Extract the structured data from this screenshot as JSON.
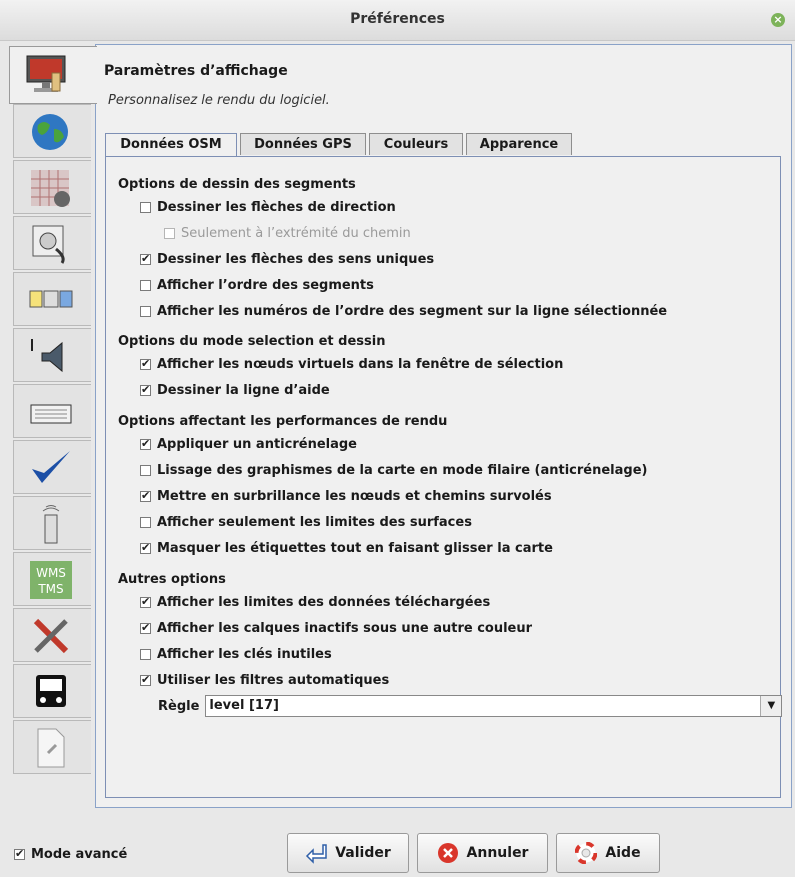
{
  "window": {
    "title": "Préférences"
  },
  "panel": {
    "title": "Paramètres d’affichage",
    "subtitle": "Personnalisez le rendu du logiciel."
  },
  "tabs": [
    "Données OSM",
    "Données GPS",
    "Couleurs",
    "Apparence"
  ],
  "sections": [
    {
      "title": "Options de dessin des segments",
      "items": [
        {
          "label": "Dessiner les flèches de direction",
          "checked": false,
          "disabled": false
        },
        {
          "label": "Seulement à l’extrémité du chemin",
          "checked": false,
          "disabled": true
        },
        {
          "label": "Dessiner les flèches des sens uniques",
          "checked": true,
          "disabled": false
        },
        {
          "label": "Afficher l’ordre des segments",
          "checked": false,
          "disabled": false
        },
        {
          "label": "Afficher les numéros de l’ordre des segment sur la ligne sélectionnée",
          "checked": false,
          "disabled": false
        }
      ]
    },
    {
      "title": "Options du mode selection et dessin",
      "items": [
        {
          "label": "Afficher les nœuds virtuels dans la fenêtre de sélection",
          "checked": true,
          "disabled": false
        },
        {
          "label": "Dessiner la ligne d’aide",
          "checked": true,
          "disabled": false
        }
      ]
    },
    {
      "title": "Options affectant les performances de rendu",
      "items": [
        {
          "label": "Appliquer un anticrénelage",
          "checked": true,
          "disabled": false
        },
        {
          "label": "Lissage des graphismes de la carte en mode filaire (anticrénelage)",
          "checked": false,
          "disabled": false
        },
        {
          "label": "Mettre en surbrillance les nœuds et chemins survolés",
          "checked": true,
          "disabled": false
        },
        {
          "label": "Afficher seulement les limites des surfaces",
          "checked": false,
          "disabled": false
        },
        {
          "label": "Masquer les étiquettes tout en faisant glisser la carte",
          "checked": true,
          "disabled": false
        }
      ]
    },
    {
      "title": "Autres options",
      "items": [
        {
          "label": "Afficher les limites des données téléchargées",
          "checked": true,
          "disabled": false
        },
        {
          "label": "Afficher les calques inactifs sous une autre couleur",
          "checked": true,
          "disabled": false
        },
        {
          "label": "Afficher les clés inutiles",
          "checked": false,
          "disabled": false
        },
        {
          "label": "Utiliser les filtres automatiques",
          "checked": true,
          "disabled": false
        }
      ]
    }
  ],
  "rule": {
    "label": "Règle",
    "value": "level [17]"
  },
  "sidebar": {
    "icons": [
      "display-icon",
      "globe-icon",
      "grid-map-icon",
      "plug-icon",
      "toolbar-icon",
      "audio-icon",
      "keyboard-icon",
      "validator-check-icon",
      "remote-control-icon",
      "wms-tms-icon",
      "tools-icon",
      "bus-icon",
      "plugin-file-icon"
    ],
    "wms_text": "WMS TMS"
  },
  "footer": {
    "expert_label": "Mode avancé",
    "expert_checked": true,
    "ok": "Valider",
    "cancel": "Annuler",
    "help": "Aide"
  }
}
